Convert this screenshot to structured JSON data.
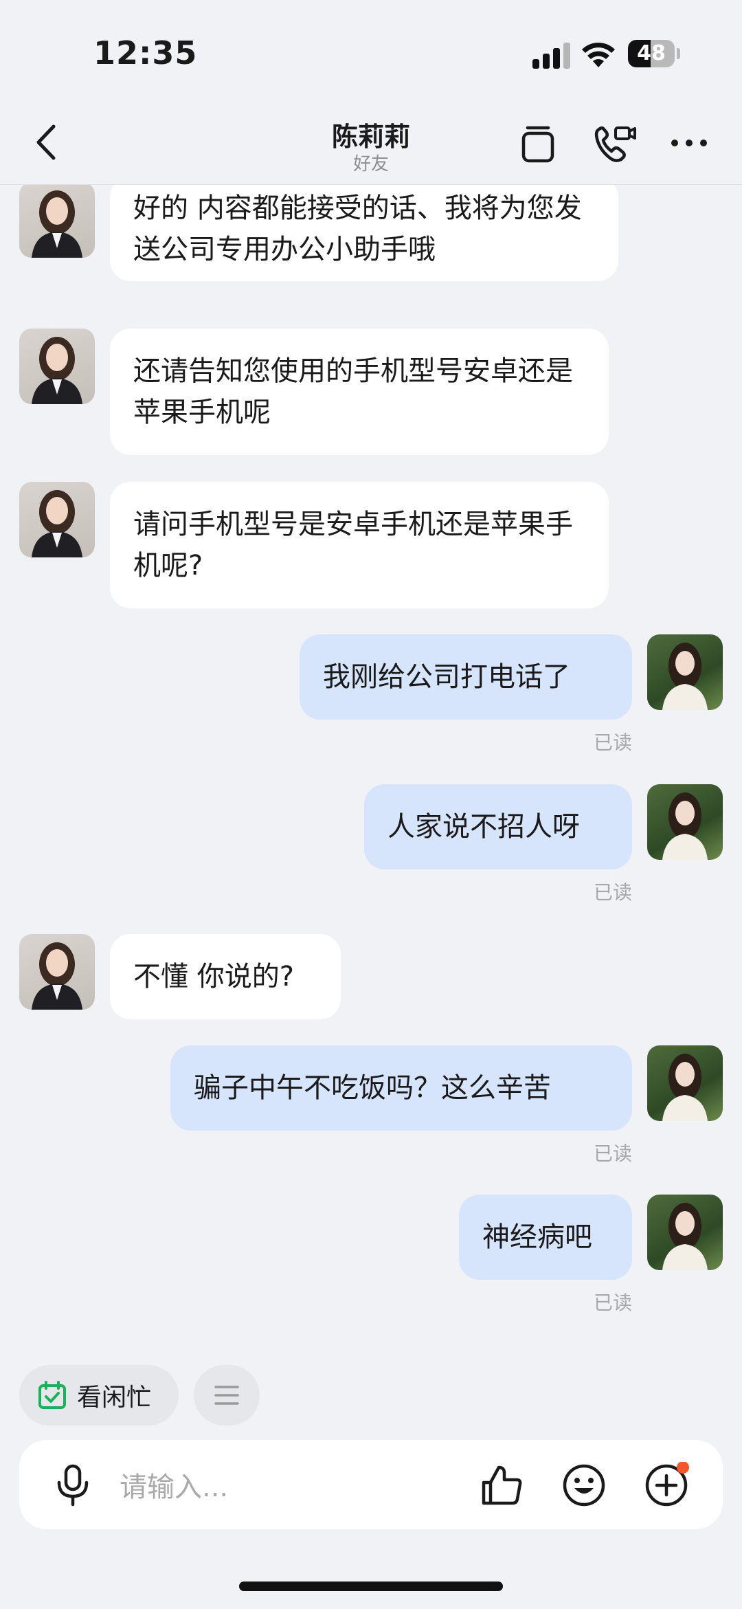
{
  "status_bar": {
    "time": "12:35",
    "battery": "48",
    "battery_level": 0.48
  },
  "header": {
    "title": "陈莉莉",
    "subtitle": "好友"
  },
  "icons": {
    "back": "chevron-left-icon",
    "copy": "stack-icon",
    "call": "video-call-icon",
    "more": "more-dots-icon",
    "voice": "microphone-icon",
    "like": "thumbs-up-icon",
    "emoji": "smile-icon",
    "plus": "plus-circle-icon",
    "busy": "calendar-check-icon",
    "menu": "menu-lines-icon"
  },
  "messages": [
    {
      "side": "left",
      "text": "好的 内容都能接受的话、我将为您发送公司专用办公小助手哦"
    },
    {
      "side": "left",
      "text": "还请告知您使用的手机型号安卓还是苹果手机呢"
    },
    {
      "side": "left",
      "text": "请问手机型号是安卓手机还是苹果手机呢?"
    },
    {
      "side": "right",
      "text": "我刚给公司打电话了",
      "status": "已读"
    },
    {
      "side": "right",
      "text": "人家说不招人呀",
      "status": "已读"
    },
    {
      "side": "left",
      "text": "不懂 你说的?"
    },
    {
      "side": "right",
      "text": "骗子中午不吃饭吗？这么辛苦",
      "status": "已读"
    },
    {
      "side": "right",
      "text": "神经病吧",
      "status": "已读"
    }
  ],
  "quick_bar": {
    "busy_label": "看闲忙"
  },
  "input": {
    "placeholder": "请输入..."
  },
  "colors": {
    "accent_green": "#16b35a",
    "notification_dot": "#f2562b",
    "sent_bubble": "#d6e4fc"
  }
}
